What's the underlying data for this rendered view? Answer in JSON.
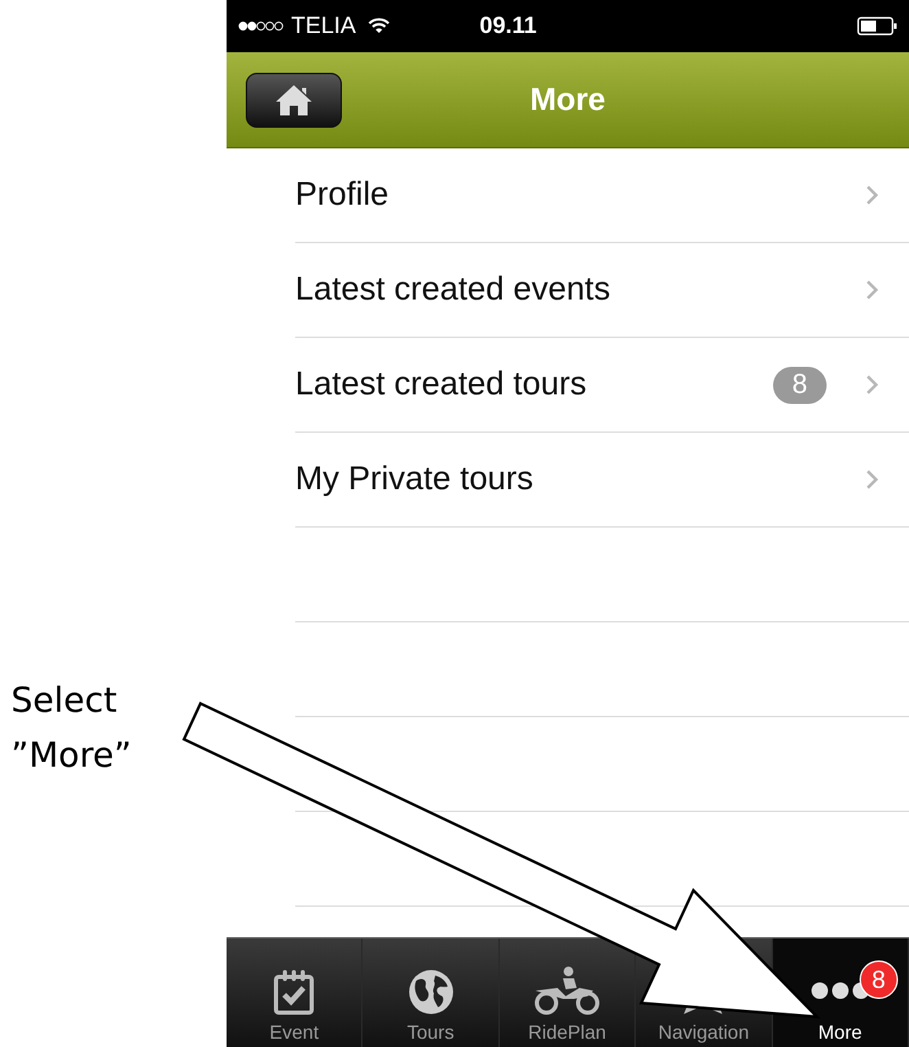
{
  "annotation": {
    "lines": [
      "Select",
      "”More”"
    ]
  },
  "status_bar": {
    "carrier": "TELIA",
    "time": "09.11"
  },
  "nav_bar": {
    "title": "More"
  },
  "menu": [
    {
      "label": "Profile"
    },
    {
      "label": "Latest created events"
    },
    {
      "label": "Latest created tours",
      "badge": "8"
    },
    {
      "label": "My Private tours"
    }
  ],
  "tab_bar": [
    {
      "kind": "event",
      "label": "Event",
      "selected": false
    },
    {
      "kind": "tours",
      "label": "Tours",
      "selected": false
    },
    {
      "kind": "rideplan",
      "label": "RidePlan",
      "selected": false
    },
    {
      "kind": "navigation",
      "label": "Navigation",
      "selected": false
    },
    {
      "kind": "more",
      "label": "More",
      "selected": true,
      "badge": "8"
    }
  ]
}
